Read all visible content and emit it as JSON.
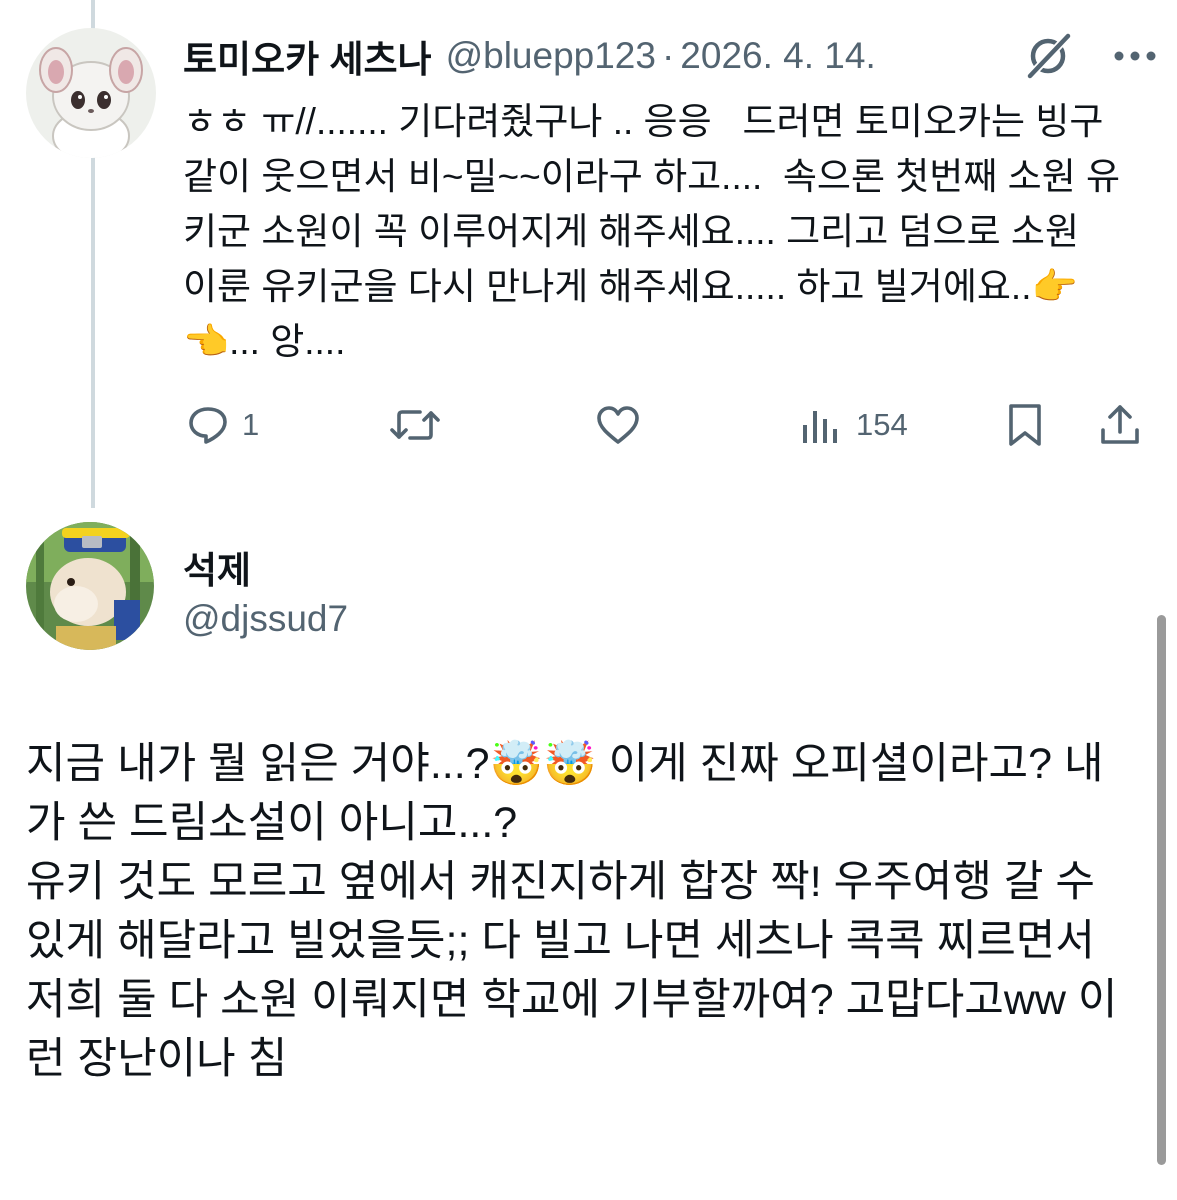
{
  "reply": {
    "display_name": "토미오카 세츠나",
    "handle": "@bluepp123",
    "separator": "·",
    "date": "2026. 4. 14.",
    "text": "ㅎㅎ ㅠ//....... 기다려줬구나 .. 응응   드러면 토미오카는 빙구같이 웃으면서 비~밀~~이라구 하고....  속으론 첫번째 소원 유키군 소원이 꼭 이루어지게 해주세요.... 그리고 덤으로 소원 이룬 유키군을 다시 만나게 해주세요..... 하고 빌거에요..👉👈... 앙....",
    "replies_count": "1",
    "views_count": "154"
  },
  "main": {
    "display_name": "석제",
    "handle": "@djssud7",
    "text": "지금 내가 뭘 읽은 거야...?🤯🤯 이게 진짜 오피셜이라고? 내가 쓴 드림소설이 아니고...?\n유키 것도 모르고 옆에서 캐진지하게 합장 짝! 우주여행 갈 수 있게 해달라고 빌었을듯;; 다 빌고 나면 세츠나 콕콕 찌르면서 저희 둘 다 소원 이뤄지면 학교에 기부할까여? 고맙다고ww 이런 장난이나 침"
  },
  "icons": {
    "grok": "grok-icon",
    "more": "more-icon",
    "reply": "reply-icon",
    "retweet": "retweet-icon",
    "like": "heart-icon",
    "views": "views-icon",
    "bookmark": "bookmark-icon",
    "share": "share-icon"
  },
  "colors": {
    "text": "#0f1419",
    "secondary": "#536471",
    "thread_line": "#cfd9de"
  }
}
